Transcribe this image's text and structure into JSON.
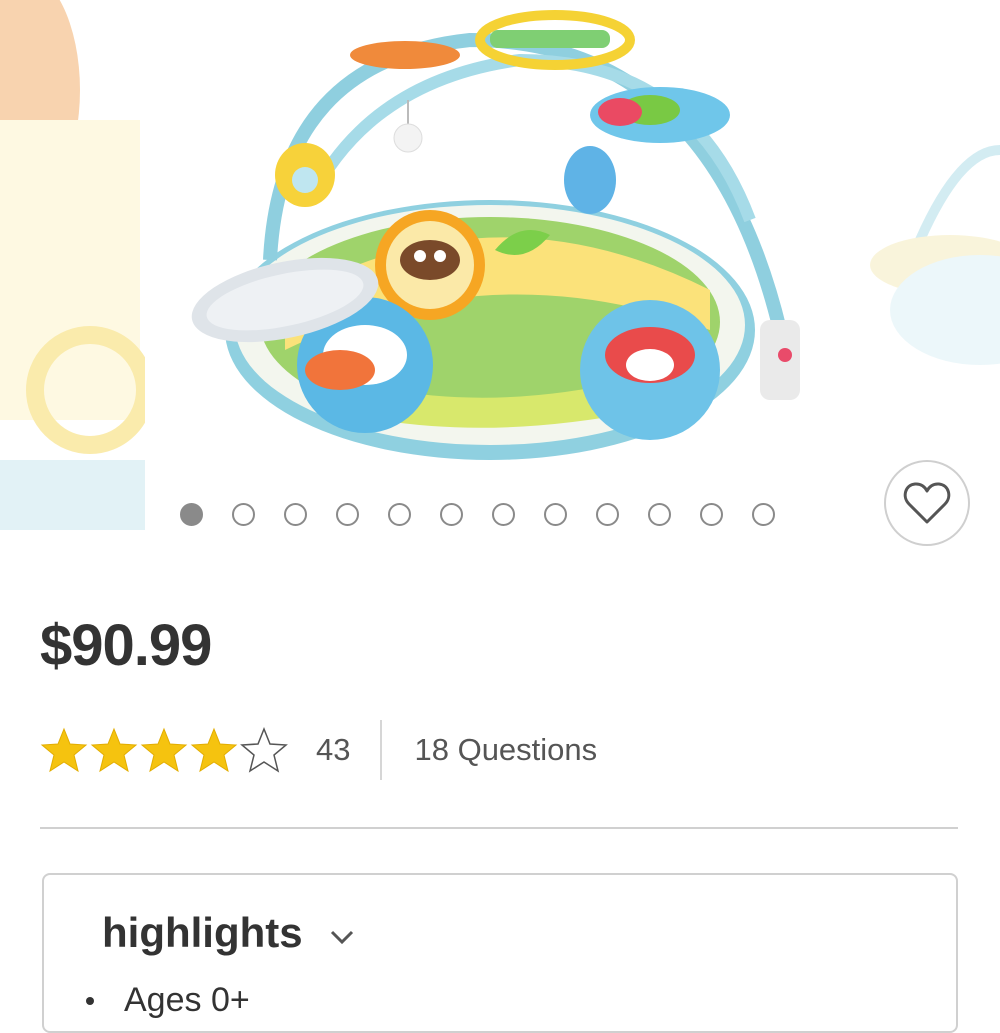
{
  "product": {
    "price": "$90.99",
    "rating": {
      "value": 4,
      "max": 5,
      "count": "43"
    },
    "questions": "18 Questions",
    "favorite_icon": "heart-outline-icon"
  },
  "carousel": {
    "image_count": 12,
    "active_index": 0
  },
  "highlights": {
    "title": "highlights",
    "items": [
      "Ages 0+"
    ]
  },
  "colors": {
    "star": "#f5c30f",
    "text": "#333333",
    "muted": "#555555",
    "divider": "#d0d0d0",
    "dot": "#8a8a8a"
  }
}
